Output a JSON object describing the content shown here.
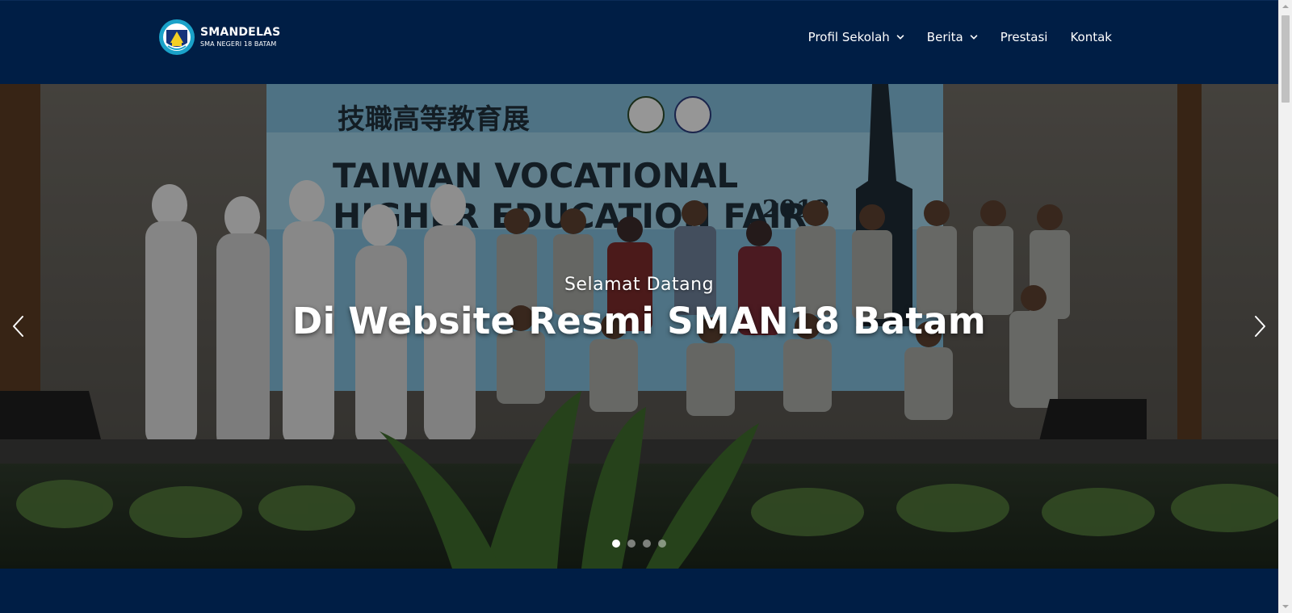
{
  "brand": {
    "name": "SMANDELAS",
    "subtitle": "SMA NEGERI 18 BATAM"
  },
  "nav": {
    "items": [
      {
        "label": "Profil Sekolah",
        "has_dropdown": true
      },
      {
        "label": "Berita",
        "has_dropdown": true
      },
      {
        "label": "Prestasi",
        "has_dropdown": false
      },
      {
        "label": "Kontak",
        "has_dropdown": false
      }
    ]
  },
  "hero": {
    "subtitle": "Selamat Datang",
    "title": "Di Website Resmi SMAN18 Batam",
    "banner_cn": "技職高等教育展",
    "banner_en": "TAIWAN VOCATIONAL",
    "banner_en2": "HIGHER EDUCATION FAIR",
    "banner_year": "2018",
    "slides_count": 4,
    "active_slide": 1
  },
  "colors": {
    "header_bg": "#001e45",
    "text": "#ffffff"
  },
  "icons": {
    "prev": "chevron-left-icon",
    "next": "chevron-right-icon",
    "dropdown": "chevron-down-icon"
  }
}
